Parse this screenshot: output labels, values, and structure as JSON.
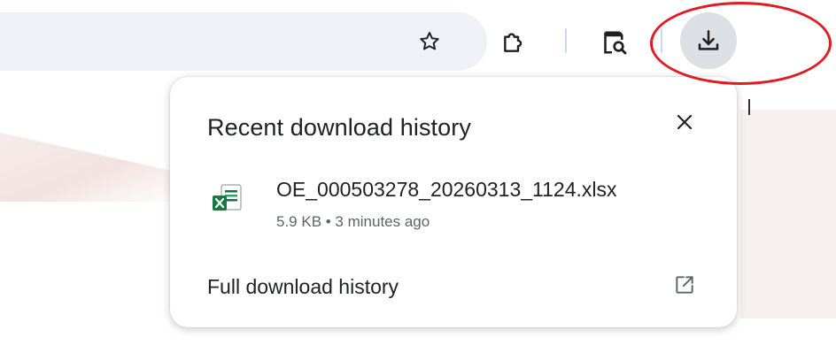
{
  "toolbar": {
    "bookmark_icon": "star-outline-icon",
    "extensions_icon": "puzzle-icon",
    "lens_icon": "page-search-icon",
    "download_icon": "download-icon"
  },
  "popup": {
    "title": "Recent download history",
    "close_icon": "close-icon",
    "items": [
      {
        "file_name": "OE_000503278_20260313_1124.xlsx",
        "meta": "5.9 KB • 3 minutes ago",
        "icon": "excel-file-icon"
      }
    ],
    "full_history_label": "Full download history",
    "open_icon": "open-in-new-icon"
  },
  "colors": {
    "annotation_red": "#e01b22",
    "download_button_bg": "#dcdfe4",
    "omnibox_bg": "#eef1f6",
    "excel_green": "#1d6f42"
  }
}
